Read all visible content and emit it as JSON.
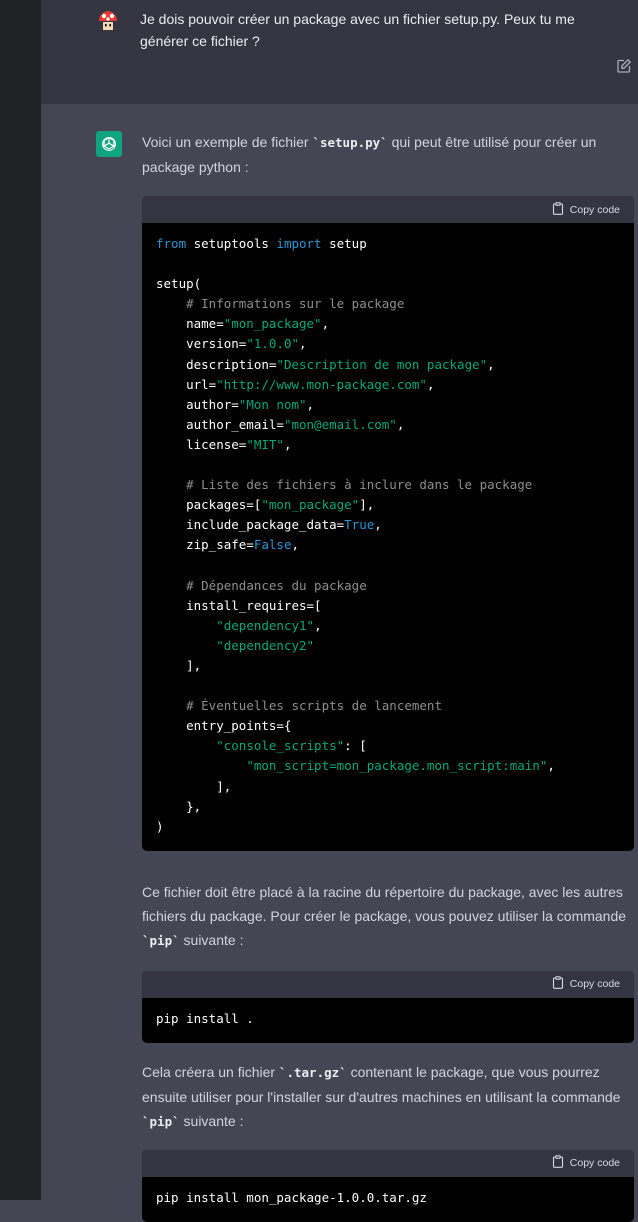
{
  "user": {
    "message": "Je dois pouvoir créer un package avec un fichier setup.py. Peux tu me générer ce fichier ?"
  },
  "assistant": {
    "intro": {
      "before": "Voici un exemple de fichier ",
      "code": "`setup.py`",
      "after": " qui peut être utilisé pour créer un package python :"
    },
    "copy_label": "Copy code",
    "code1": {
      "lines": [
        "from setuptools import setup",
        "",
        "setup(",
        "    # Informations sur le package",
        "    name=\"mon_package\",",
        "    version=\"1.0.0\",",
        "    description=\"Description de mon package\",",
        "    url=\"http://www.mon-package.com\",",
        "    author=\"Mon nom\",",
        "    author_email=\"mon@email.com\",",
        "    license=\"MIT\",",
        "",
        "    # Liste des fichiers à inclure dans le package",
        "    packages=[\"mon_package\"],",
        "    include_package_data=True,",
        "    zip_safe=False,",
        "",
        "    # Dépendances du package",
        "    install_requires=[",
        "        \"dependency1\",",
        "        \"dependency2\"",
        "    ],",
        "",
        "    # Éventuelles scripts de lancement",
        "    entry_points={",
        "        \"console_scripts\": [",
        "            \"mon_script=mon_package.mon_script:main\",",
        "        ],",
        "    },",
        ")"
      ]
    },
    "para2": {
      "before": "Ce fichier doit être placé à la racine du répertoire du package, avec les autres fichiers du package. Pour créer le package, vous pouvez utiliser la commande ",
      "code": "`pip`",
      "after": " suivante :"
    },
    "code2": "pip install .",
    "para3": {
      "before": "Cela créera un fichier ",
      "code1": "`.tar.gz`",
      "middle": " contenant le package, que vous pourrez ensuite utiliser pour l'installer sur d'autres machines en utilisant la commande ",
      "code2": "`pip`",
      "after": " suivante :"
    },
    "code3": "pip install mon_package-1.0.0.tar.gz"
  },
  "icons": [
    "user-avatar-icon",
    "edit-icon",
    "openai-logo-icon",
    "clipboard-icon"
  ],
  "colors": {
    "sidebar": "#202123",
    "user_bg": "#343541",
    "assistant_bg": "#444654",
    "code_bg": "#000000",
    "keyword": "#2e95d3",
    "string": "#00a67d",
    "comment": "#8e8e8e",
    "logo_bg": "#10a37f"
  }
}
